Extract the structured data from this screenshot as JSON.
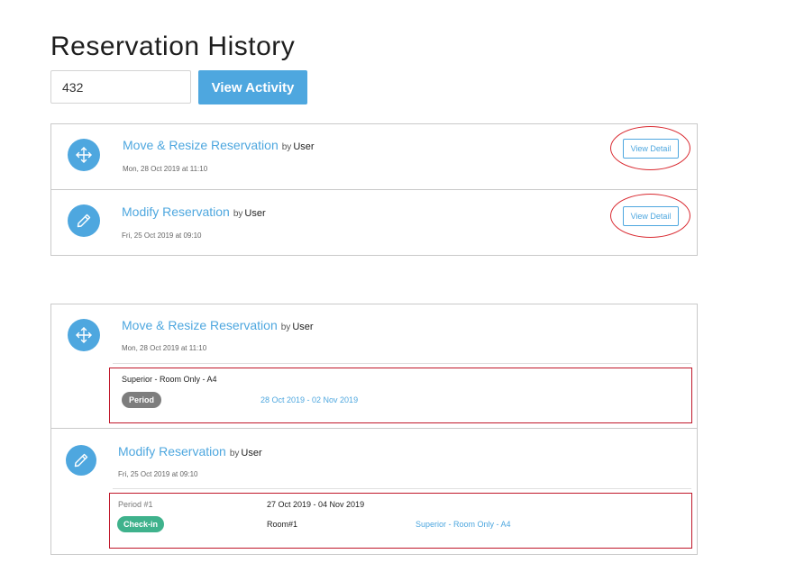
{
  "page": {
    "title": "Reservation History"
  },
  "search": {
    "value": "432",
    "button_label": "View Activity"
  },
  "summary_list": [
    {
      "activity": "Move & Resize Reservation",
      "by": "by",
      "user": "User",
      "date": "Mon, 28 Oct 2019 at 11:10",
      "detail_label": "View Detail",
      "icon": "move-arrows-icon"
    },
    {
      "activity": "Modify Reservation",
      "by": "by",
      "user": "User",
      "date": "Fri, 25 Oct 2019 at 09:10",
      "detail_label": "View Detail",
      "icon": "pencil-icon"
    }
  ],
  "detail_list": [
    {
      "activity": "Move & Resize Reservation",
      "by": "by",
      "user": "User",
      "date": "Mon, 28 Oct 2019 at 11:10",
      "icon": "move-arrows-icon",
      "room_type": "Superior - Room Only - A4",
      "badge": "Period",
      "badge_color": "#7d7d7d",
      "period": "28 Oct 2019 - 02 Nov 2019"
    },
    {
      "activity": "Modify Reservation",
      "by": "by",
      "user": "User",
      "date": "Fri, 25 Oct 2019 at 09:10",
      "icon": "pencil-icon",
      "period_label": "Period #1",
      "period": "27 Oct 2019 - 04 Nov 2019",
      "badge": "Check-in",
      "badge_color": "#3fb28c",
      "room": "Room#1",
      "room_type": "Superior - Room Only - A4"
    }
  ],
  "colors": {
    "accent": "#4ea7df",
    "highlight": "#d9282f"
  }
}
